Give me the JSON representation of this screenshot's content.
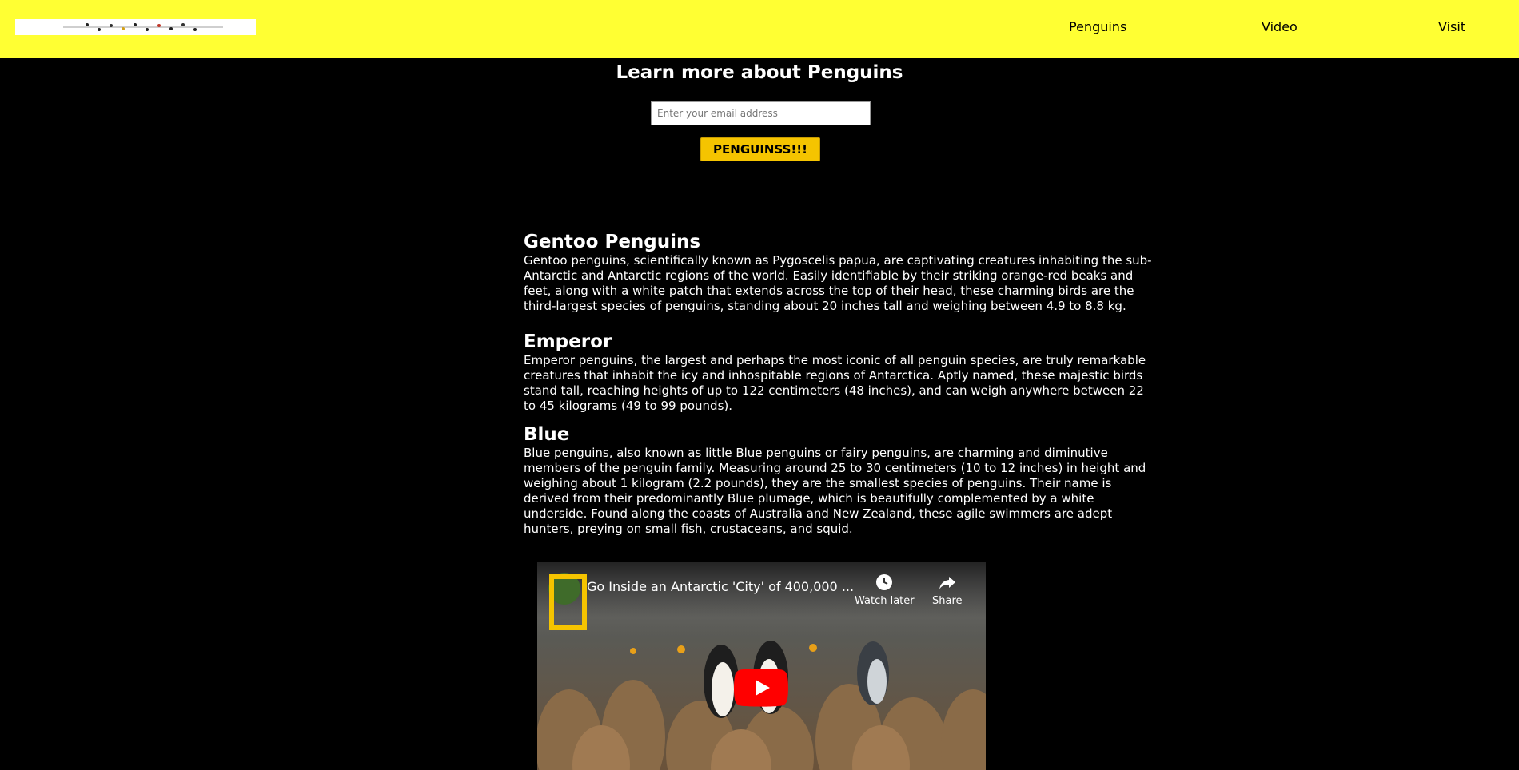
{
  "header": {
    "logo_alt": "logo",
    "nav": [
      "Penguins",
      "Video",
      "Visit"
    ]
  },
  "signup": {
    "title": "Learn more about Penguins",
    "email_placeholder": "Enter your email address",
    "button_label": "PENGUINSS!!!"
  },
  "sections": [
    {
      "heading": "Gentoo Penguins",
      "body": "Gentoo penguins, scientifically known as Pygoscelis papua, are captivating creatures inhabiting the sub-Antarctic and Antarctic regions of the world. Easily identifiable by their striking orange-red beaks and feet, along with a white patch that extends across the top of their head, these charming birds are the third-largest species of penguins, standing about 20 inches tall and weighing between 4.9 to 8.8 kg."
    },
    {
      "heading": "Emperor",
      "body": "Emperor penguins, the largest and perhaps the most iconic of all penguin species, are truly remarkable creatures that inhabit the icy and inhospitable regions of Antarctica. Aptly named, these majestic birds stand tall, reaching heights of up to 122 centimeters (48 inches), and can weigh anywhere between 22 to 45 kilograms (49 to 99 pounds)."
    },
    {
      "heading": "Blue",
      "body": "Blue penguins, also known as little Blue penguins or fairy penguins, are charming and diminutive members of the penguin family. Measuring around 25 to 30 centimeters (10 to 12 inches) in height and weighing about 1 kilogram (2.2 pounds), they are the smallest species of penguins. Their name is derived from their predominantly Blue plumage, which is beautifully complemented by a white underside. Found along the coasts of Australia and New Zealand, these agile swimmers are adept hunters, preying on small fish, crustaceans, and squid."
    }
  ],
  "video": {
    "title": "Go Inside an Antarctic 'City' of 400,000 ...",
    "watch_later_label": "Watch later",
    "share_label": "Share"
  },
  "colors": {
    "header_bg": "#ffff33",
    "page_bg": "#000000",
    "button_bg": "#f5c400",
    "accent_yellow": "#f5c400",
    "play_red": "#ff0000"
  },
  "icons": [
    "clock-icon",
    "share-arrow-icon",
    "play-icon",
    "channel-logo-icon"
  ]
}
